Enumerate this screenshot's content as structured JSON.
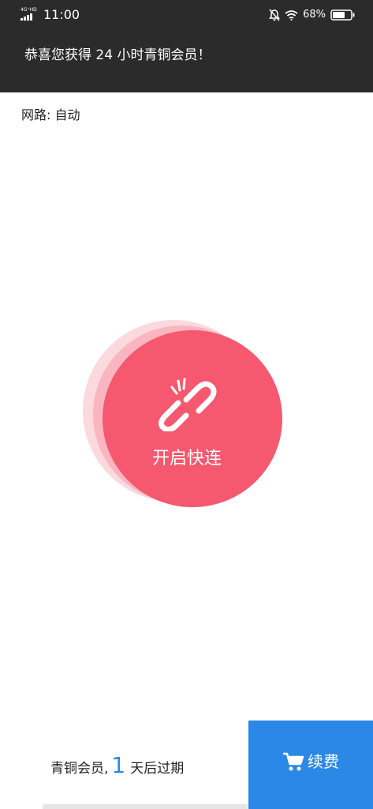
{
  "status_bar": {
    "network_type": "4G⁺HD",
    "time": "11:00",
    "battery_percent": "68%",
    "icons": [
      "signal-icon",
      "mute-icon",
      "wifi-icon",
      "battery-icon"
    ]
  },
  "banner": {
    "message": "恭喜您获得 24 小时青铜会员！"
  },
  "route": {
    "label": "网路: 自动"
  },
  "connect": {
    "label": "开启快连",
    "icon": "broken-link-icon",
    "color": "#f5586f"
  },
  "footer": {
    "membership_prefix": "青铜会员,",
    "days_left": "1",
    "membership_suffix": "天后过期",
    "renew_label": "续费",
    "renew_icon": "cart-icon",
    "accent_color": "#2b88e6"
  }
}
